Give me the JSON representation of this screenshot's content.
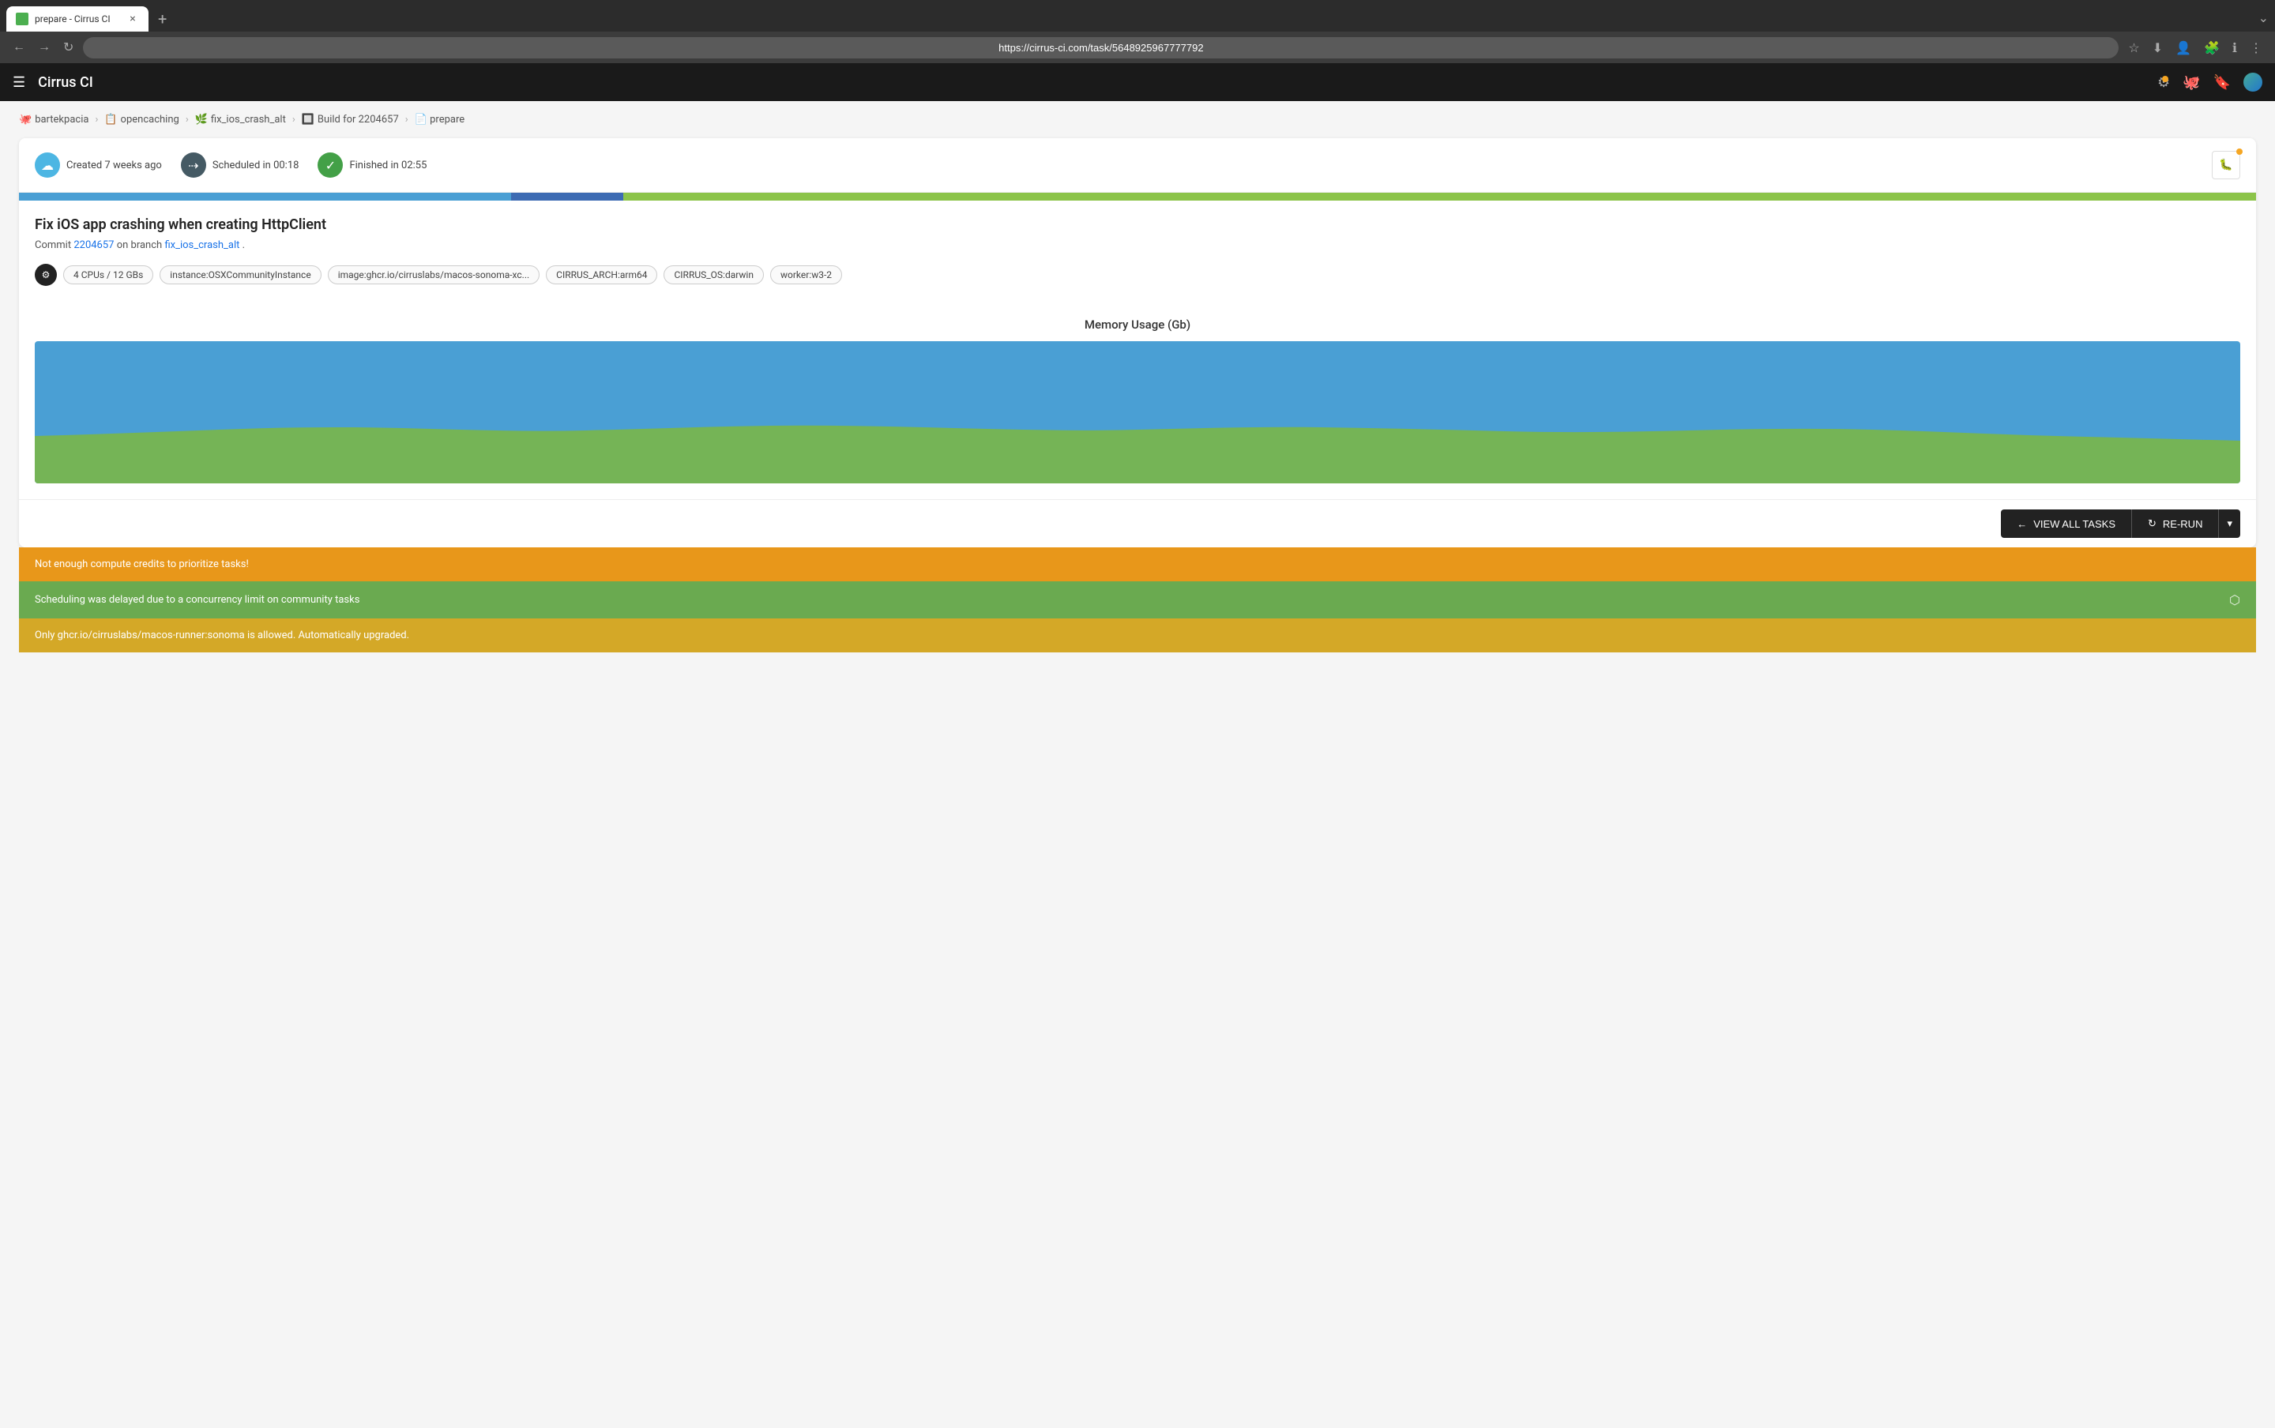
{
  "browser": {
    "tab_title": "prepare - Cirrus CI",
    "tab_close": "×",
    "tab_new": "+",
    "url": "https://cirrus-ci.com/task/5648925967777792",
    "nav_back": "←",
    "nav_forward": "→",
    "nav_refresh": "↻"
  },
  "header": {
    "title": "Cirrus CI",
    "hamburger": "☰"
  },
  "breadcrumb": {
    "items": [
      {
        "icon": "🐙",
        "label": "bartekpacia"
      },
      {
        "icon": "📋",
        "label": "opencaching"
      },
      {
        "icon": "🌿",
        "label": "fix_ios_crash_alt"
      },
      {
        "icon": "🔲",
        "label": "Build for 2204657"
      },
      {
        "icon": "📄",
        "label": "prepare"
      }
    ],
    "separators": [
      ">",
      ">",
      ">",
      ">"
    ]
  },
  "status": {
    "created_label": "Created 7 weeks ago",
    "scheduled_label": "Scheduled in 00:18",
    "finished_label": "Finished in 02:55"
  },
  "progress": {
    "blue_width": "22%",
    "blue2_width": "5%"
  },
  "task": {
    "title": "Fix iOS app crashing when creating HttpClient",
    "commit_text": "Commit",
    "commit_hash": "2204657",
    "commit_mid": " on branch ",
    "branch_name": "fix_ios_crash_alt",
    "commit_end": "."
  },
  "tags": [
    {
      "id": "cpu",
      "label": "4 CPUs / 12 GBs"
    },
    {
      "id": "instance",
      "label": "instance:OSXCommunityInstance"
    },
    {
      "id": "image",
      "label": "image:ghcr.io/cirruslabs/macos-sonoma-xc..."
    },
    {
      "id": "arch",
      "label": "CIRRUS_ARCH:arm64"
    },
    {
      "id": "os",
      "label": "CIRRUS_OS:darwin"
    },
    {
      "id": "worker",
      "label": "worker:w3-2"
    }
  ],
  "chart": {
    "title": "Memory Usage (Gb)"
  },
  "buttons": {
    "view_all": "VIEW ALL TASKS",
    "rerun": "RE-RUN"
  },
  "notifications": [
    {
      "id": "notif-credits",
      "type": "orange",
      "text": "Not enough compute credits to prioritize tasks!"
    },
    {
      "id": "notif-scheduling",
      "type": "green",
      "text": "Scheduling was delayed due to a concurrency limit on community tasks",
      "has_link": true
    },
    {
      "id": "notif-upgrade",
      "type": "yellow",
      "text": "Only ghcr.io/cirruslabs/macos-runner:sonoma is allowed. Automatically upgraded."
    }
  ]
}
